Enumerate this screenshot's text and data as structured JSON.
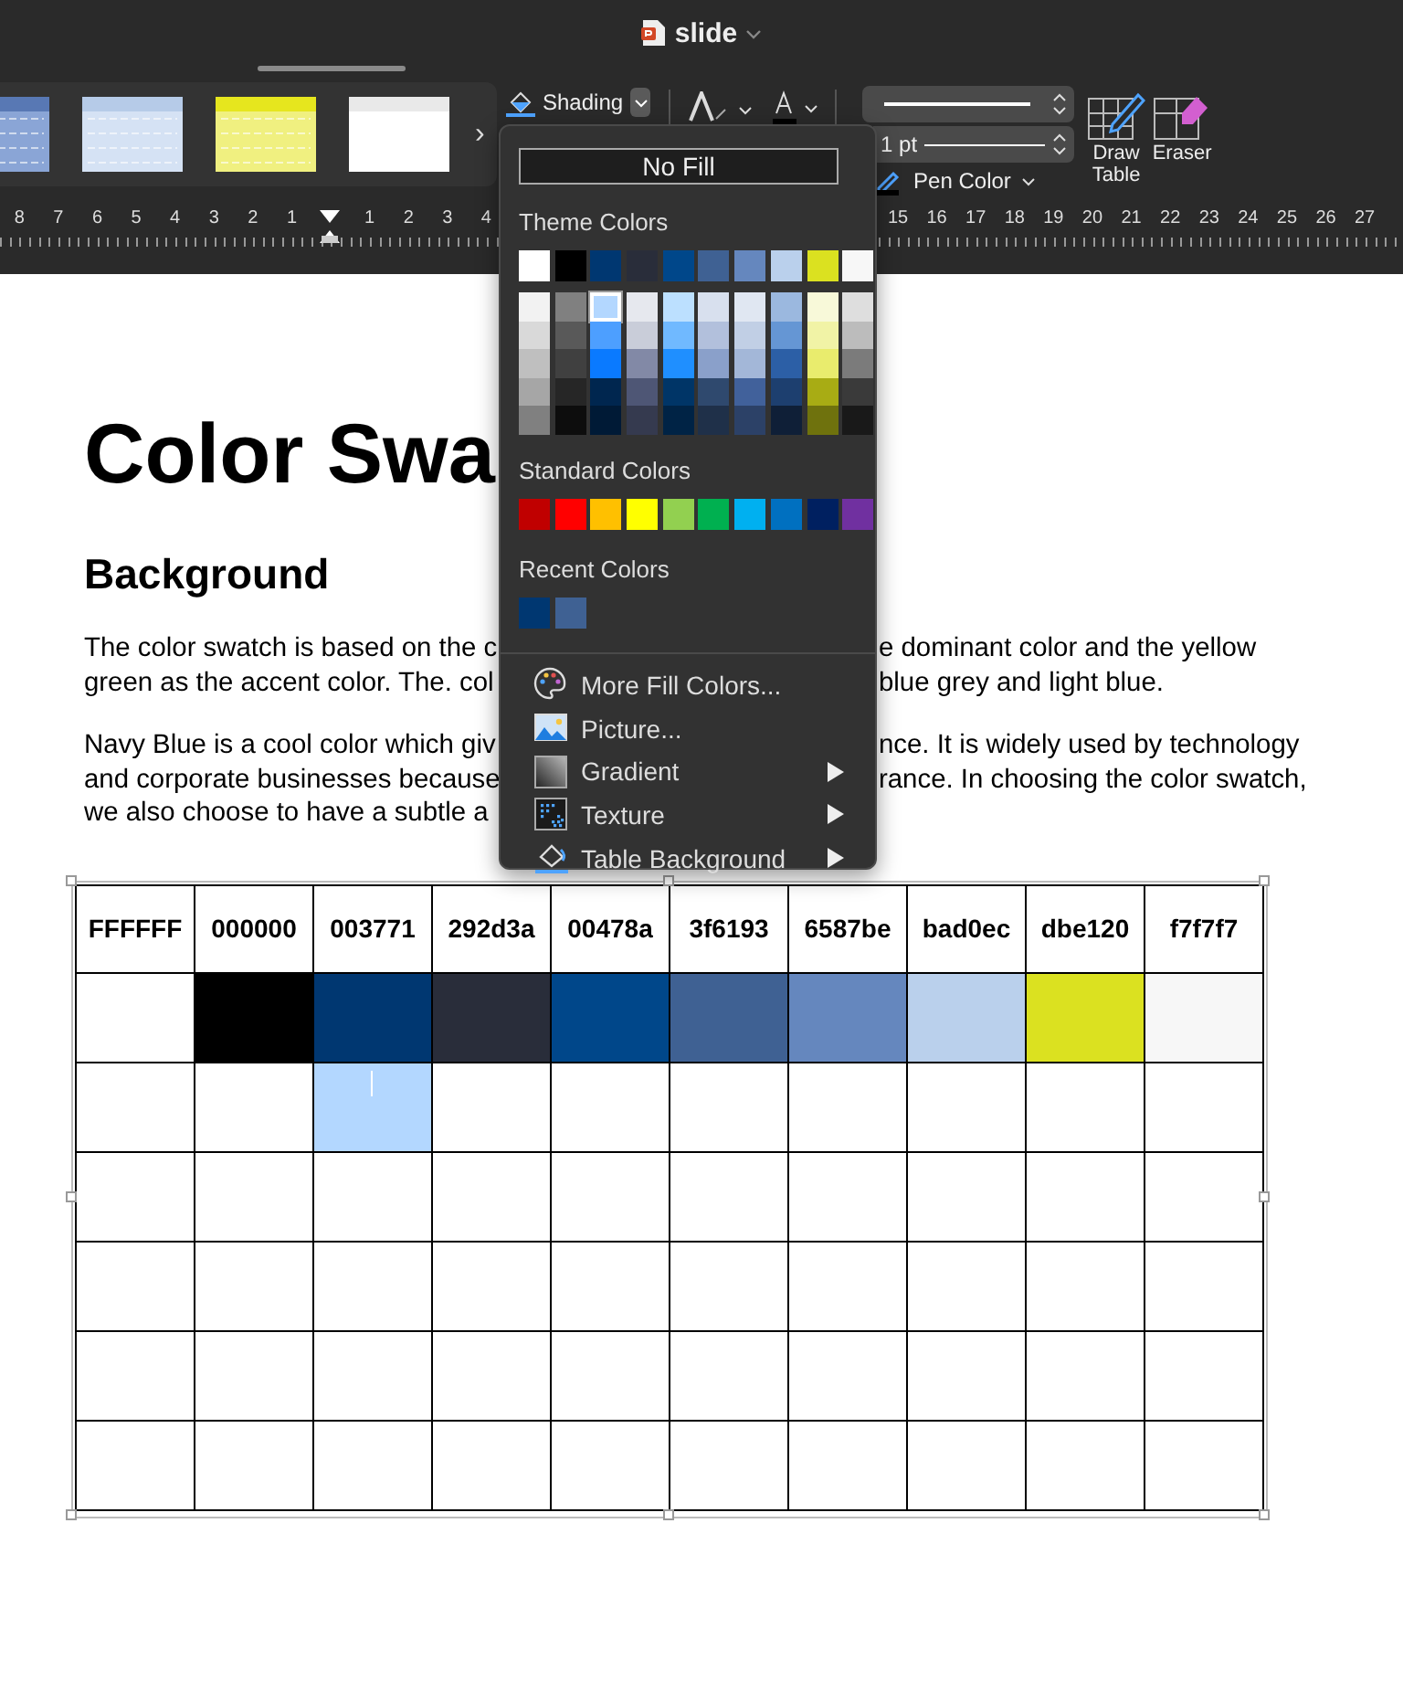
{
  "window": {
    "title": "slide"
  },
  "ribbon": {
    "gallery_more": "›",
    "shading_label": "Shading",
    "line_weight": "1 pt",
    "pen_color_label": "Pen Color",
    "draw_table_label": "Draw Table",
    "eraser_label": "Eraser"
  },
  "ruler": {
    "left_labels": [
      "8",
      "7",
      "6",
      "5",
      "4",
      "3",
      "2",
      "1"
    ],
    "middle_labels": [
      "1",
      "2",
      "3",
      "4"
    ],
    "right_labels": [
      "15",
      "16",
      "17",
      "18",
      "19",
      "20",
      "21",
      "22",
      "23",
      "24",
      "25",
      "26",
      "27"
    ]
  },
  "document": {
    "title": "Color Swa",
    "heading": "Background",
    "paragraphs": [
      {
        "lines": [
          {
            "left": "The color swatch is based on the c",
            "right": "e dominant color and the yellow"
          },
          {
            "left": "green as the accent color. The. col",
            "right": "blue grey and light blue."
          }
        ]
      },
      {
        "lines": [
          {
            "left": "Navy Blue is a cool color which giv",
            "right": "nce. It is widely used by technology"
          },
          {
            "left": "and corporate businesses because",
            "right": "rance. In choosing the color swatch,"
          },
          {
            "left": "we also choose to have a subtle a"
          }
        ]
      }
    ]
  },
  "table": {
    "columns": [
      "FFFFFF",
      "000000",
      "003771",
      "292d3a",
      "00478a",
      "3f6193",
      "6587be",
      "bad0ec",
      "dbe120",
      "f7f7f7"
    ],
    "rows": [
      {
        "cells": [
          {
            "color": "#ffffff",
            "selected": false
          },
          {
            "color": "#000000",
            "selected": false
          },
          {
            "color": "#003771",
            "selected": false
          },
          {
            "color": "#292d3a",
            "selected": false
          },
          {
            "color": "#00478a",
            "selected": false
          },
          {
            "color": "#3f6193",
            "selected": false
          },
          {
            "color": "#6587be",
            "selected": false
          },
          {
            "color": "#bad0ec",
            "selected": false
          },
          {
            "color": "#dbe120",
            "selected": false
          },
          {
            "color": "#f7f7f7",
            "selected": false
          }
        ]
      },
      {
        "cells": [
          {
            "selected": false
          },
          {
            "selected": false
          },
          {
            "selected": true
          },
          {
            "selected": false
          },
          {
            "selected": false
          },
          {
            "selected": false
          },
          {
            "selected": false
          },
          {
            "selected": false
          },
          {
            "selected": false
          },
          {
            "selected": false
          }
        ]
      },
      {
        "cells": [
          {
            "selected": false
          },
          {
            "selected": false
          },
          {
            "selected": false
          },
          {
            "selected": false
          },
          {
            "selected": false
          },
          {
            "selected": false
          },
          {
            "selected": false
          },
          {
            "selected": false
          },
          {
            "selected": false
          },
          {
            "selected": false
          }
        ]
      },
      {
        "cells": [
          {
            "selected": false
          },
          {
            "selected": false
          },
          {
            "selected": false
          },
          {
            "selected": false
          },
          {
            "selected": false
          },
          {
            "selected": false
          },
          {
            "selected": false
          },
          {
            "selected": false
          },
          {
            "selected": false
          },
          {
            "selected": false
          }
        ]
      },
      {
        "cells": [
          {
            "selected": false
          },
          {
            "selected": false
          },
          {
            "selected": false
          },
          {
            "selected": false
          },
          {
            "selected": false
          },
          {
            "selected": false
          },
          {
            "selected": false
          },
          {
            "selected": false
          },
          {
            "selected": false
          },
          {
            "selected": false
          }
        ]
      },
      {
        "cells": [
          {
            "selected": false
          },
          {
            "selected": false
          },
          {
            "selected": false
          },
          {
            "selected": false
          },
          {
            "selected": false
          },
          {
            "selected": false
          },
          {
            "selected": false
          },
          {
            "selected": false
          },
          {
            "selected": false
          },
          {
            "selected": false
          }
        ]
      }
    ]
  },
  "fill_menu": {
    "no_fill": "No Fill",
    "theme_title": "Theme Colors",
    "theme_top": [
      {
        "color": "#ffffff",
        "selected": false
      },
      {
        "color": "#000000",
        "selected": false
      },
      {
        "color": "#003771",
        "selected": false
      },
      {
        "color": "#292d3a",
        "selected": false
      },
      {
        "color": "#00478a",
        "selected": false
      },
      {
        "color": "#3f6193",
        "selected": false
      },
      {
        "color": "#6587be",
        "selected": false
      },
      {
        "color": "#bad0ec",
        "selected": false
      },
      {
        "color": "#dbe120",
        "selected": false
      },
      {
        "color": "#f7f7f7",
        "selected": false
      }
    ],
    "theme_shades": [
      {
        "swatches": [
          {
            "color": "#f2f2f2",
            "selected": false
          },
          {
            "color": "#d9d9d9",
            "selected": false
          },
          {
            "color": "#bfbfbf",
            "selected": false
          },
          {
            "color": "#a6a6a6",
            "selected": false
          },
          {
            "color": "#808080",
            "selected": false
          }
        ]
      },
      {
        "swatches": [
          {
            "color": "#808080",
            "selected": false
          },
          {
            "color": "#595959",
            "selected": false
          },
          {
            "color": "#404040",
            "selected": false
          },
          {
            "color": "#262626",
            "selected": false
          },
          {
            "color": "#0d0d0d",
            "selected": false
          }
        ]
      },
      {
        "swatches": [
          {
            "color": "#b3d7ff",
            "selected": true
          },
          {
            "color": "#4d9fff",
            "selected": false
          },
          {
            "color": "#0a7aff",
            "selected": false
          },
          {
            "color": "#00264f",
            "selected": false
          },
          {
            "color": "#001a36",
            "selected": false
          }
        ]
      },
      {
        "swatches": [
          {
            "color": "#e6e8ee",
            "selected": false
          },
          {
            "color": "#c9cdd9",
            "selected": false
          },
          {
            "color": "#8289a6",
            "selected": false
          },
          {
            "color": "#4e5675",
            "selected": false
          },
          {
            "color": "#353a4f",
            "selected": false
          }
        ]
      },
      {
        "swatches": [
          {
            "color": "#bce0ff",
            "selected": false
          },
          {
            "color": "#70b9ff",
            "selected": false
          },
          {
            "color": "#1f8fff",
            "selected": false
          },
          {
            "color": "#003567",
            "selected": false
          },
          {
            "color": "#002345",
            "selected": false
          }
        ]
      },
      {
        "swatches": [
          {
            "color": "#d8e0ee",
            "selected": false
          },
          {
            "color": "#b2c0dc",
            "selected": false
          },
          {
            "color": "#8aa0ca",
            "selected": false
          },
          {
            "color": "#2f496e",
            "selected": false
          },
          {
            "color": "#1f3049",
            "selected": false
          }
        ]
      },
      {
        "swatches": [
          {
            "color": "#e0e7f2",
            "selected": false
          },
          {
            "color": "#c1cfe5",
            "selected": false
          },
          {
            "color": "#a3b7d8",
            "selected": false
          },
          {
            "color": "#41619b",
            "selected": false
          },
          {
            "color": "#2c4167",
            "selected": false
          }
        ]
      },
      {
        "swatches": [
          {
            "color": "#9bb8df",
            "selected": false
          },
          {
            "color": "#6596d4",
            "selected": false
          },
          {
            "color": "#2c5fa6",
            "selected": false
          },
          {
            "color": "#1d3f6f",
            "selected": false
          },
          {
            "color": "#0f1f37",
            "selected": false
          }
        ]
      },
      {
        "swatches": [
          {
            "color": "#f8f9d9",
            "selected": false
          },
          {
            "color": "#f1f3a6",
            "selected": false
          },
          {
            "color": "#e9ec6d",
            "selected": false
          },
          {
            "color": "#a8ac14",
            "selected": false
          },
          {
            "color": "#6f720d",
            "selected": false
          }
        ]
      },
      {
        "swatches": [
          {
            "color": "#dedede",
            "selected": false
          },
          {
            "color": "#bcbcbc",
            "selected": false
          },
          {
            "color": "#7b7b7b",
            "selected": false
          },
          {
            "color": "#3a3a3a",
            "selected": false
          },
          {
            "color": "#191919",
            "selected": false
          }
        ]
      }
    ],
    "standard_title": "Standard Colors",
    "standard": [
      {
        "color": "#c00000",
        "selected": false
      },
      {
        "color": "#ff0000",
        "selected": false
      },
      {
        "color": "#ffc000",
        "selected": false
      },
      {
        "color": "#ffff00",
        "selected": false
      },
      {
        "color": "#92d050",
        "selected": false
      },
      {
        "color": "#00b050",
        "selected": false
      },
      {
        "color": "#00b0f0",
        "selected": false
      },
      {
        "color": "#0070c0",
        "selected": false
      },
      {
        "color": "#002060",
        "selected": false
      },
      {
        "color": "#7030a0",
        "selected": false
      }
    ],
    "recent_title": "Recent Colors",
    "recent": [
      {
        "color": "#003771",
        "selected": false
      },
      {
        "color": "#3f6193",
        "selected": false
      }
    ],
    "items": [
      {
        "kind": "palette",
        "label": "More Fill Colors...",
        "submenu": false
      },
      {
        "kind": "picture",
        "label": "Picture...",
        "submenu": false
      },
      {
        "kind": "gradient",
        "label": "Gradient",
        "submenu": true
      },
      {
        "kind": "texture",
        "label": "Texture",
        "submenu": true
      },
      {
        "kind": "bucket",
        "label": "Table Background",
        "submenu": true
      }
    ]
  }
}
